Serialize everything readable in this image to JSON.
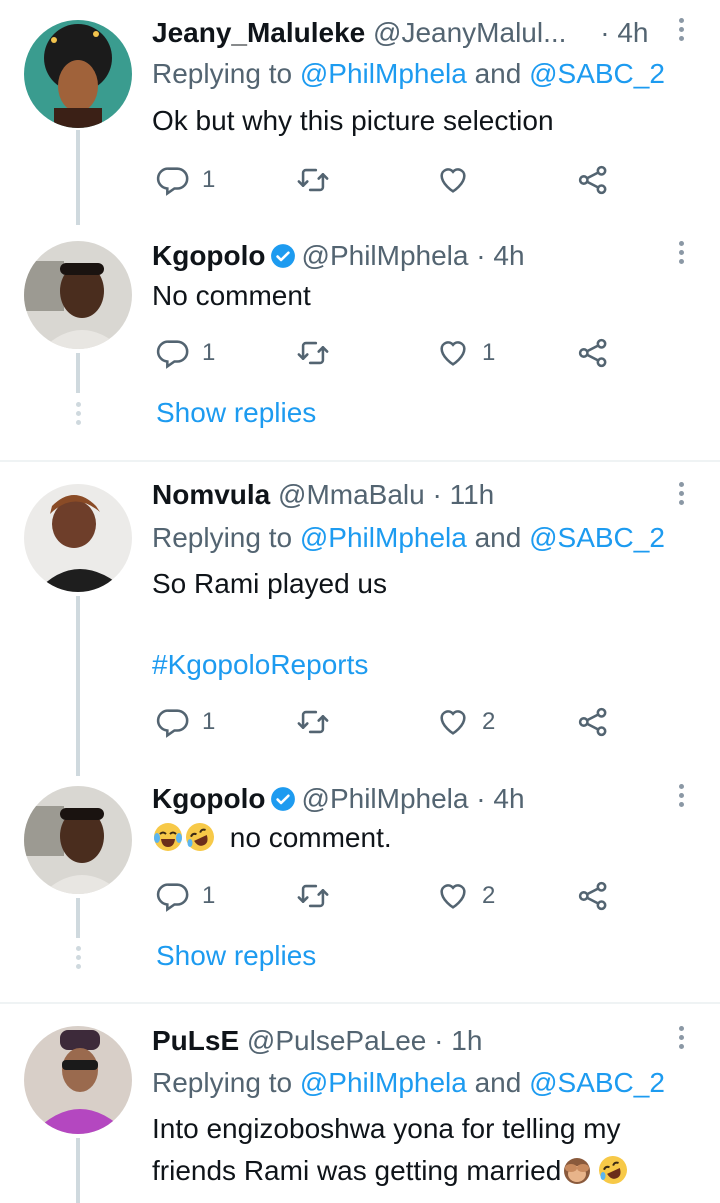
{
  "tweets": [
    {
      "name": "Jeany_Maluleke",
      "handle": "@JeanyMalul...",
      "dot": "·",
      "time": "4h",
      "replying_prefix": "Replying to ",
      "reply_to_1": "@PhilMphela",
      "reply_and": " and ",
      "reply_to_2": "@SABC_2",
      "text": "Ok but why this picture selection",
      "replies": "1",
      "retweets": "",
      "likes": ""
    },
    {
      "name": "Kgopolo",
      "handle": "@PhilMphela",
      "dot": "·",
      "time": "4h",
      "text": "No comment",
      "replies": "1",
      "retweets": "",
      "likes": "1",
      "show_replies": "Show replies"
    },
    {
      "name": "Nomvula",
      "handle": "@MmaBalu",
      "dot": "·",
      "time": "11h",
      "replying_prefix": "Replying to ",
      "reply_to_1": "@PhilMphela",
      "reply_and": " and ",
      "reply_to_2": "@SABC_2",
      "text": "So Rami played us",
      "hashtag": "#KgopoloReports",
      "replies": "1",
      "retweets": "",
      "likes": "2"
    },
    {
      "name": "Kgopolo",
      "handle": "@PhilMphela",
      "dot": "·",
      "time": "4h",
      "text": "no comment.",
      "replies": "1",
      "retweets": "",
      "likes": "2",
      "show_replies": "Show replies"
    },
    {
      "name": "PuLsE",
      "handle": "@PulsePaLee",
      "dot": "·",
      "time": "1h",
      "replying_prefix": "Replying to ",
      "reply_to_1": "@PhilMphela",
      "reply_and": " and ",
      "reply_to_2": "@SABC_2",
      "text_line1": "Into engizoboshwa yona for telling my",
      "text_line2": "friends Rami was getting married"
    }
  ],
  "colors": {
    "accent": "#1d9bf0",
    "muted": "#536471",
    "thread_line": "#cfd9de",
    "divider": "#eff3f4"
  },
  "icons": {
    "reply": "reply-icon",
    "retweet": "retweet-icon",
    "like": "heart-icon",
    "share": "share-icon",
    "more": "more-icon",
    "verified": "verified-badge-icon"
  }
}
